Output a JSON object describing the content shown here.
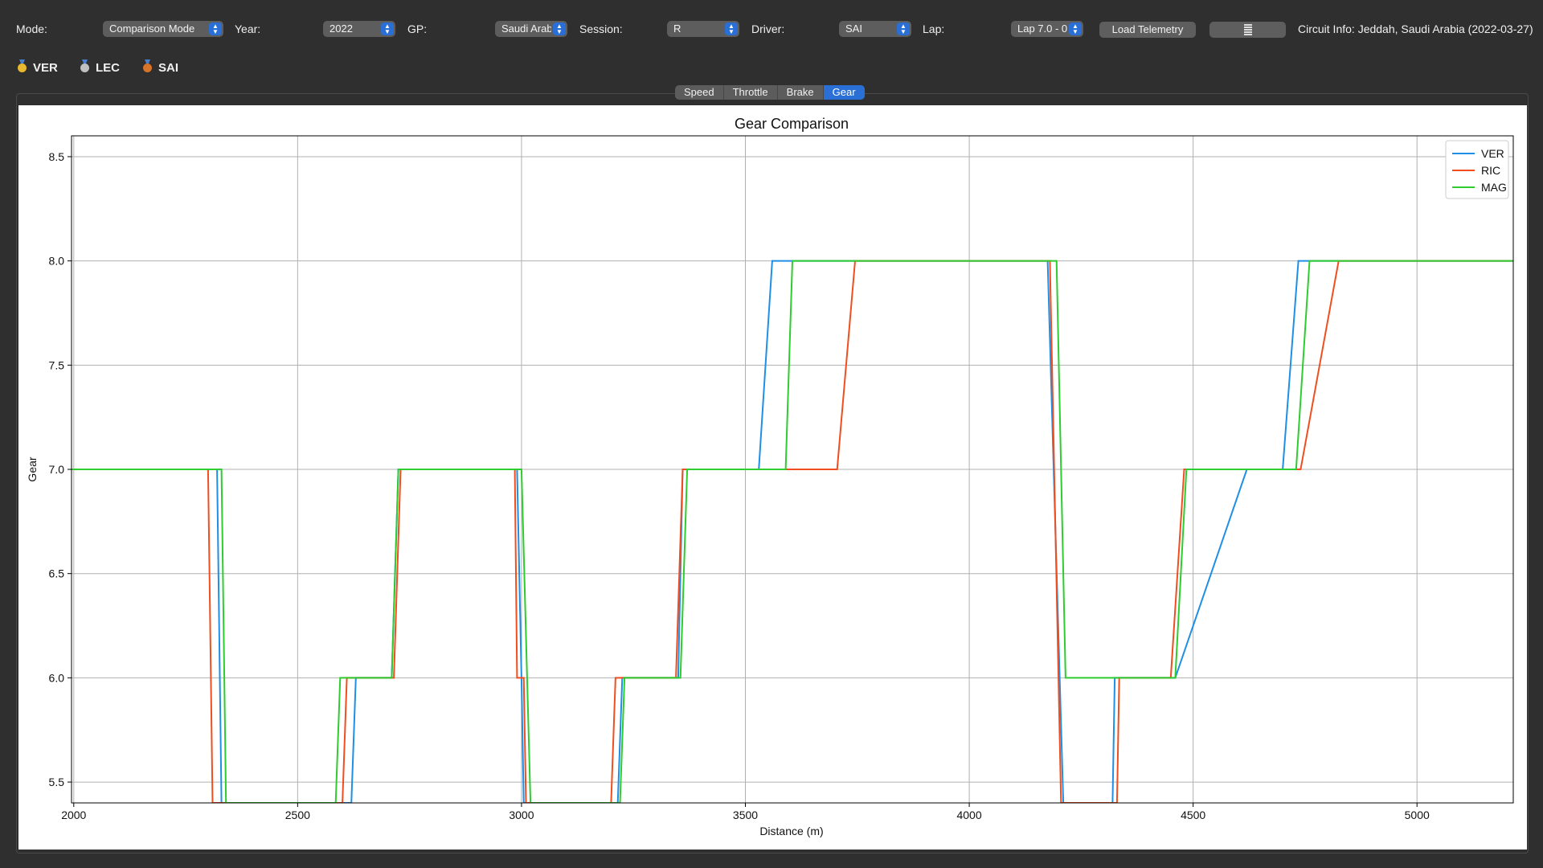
{
  "toolbar": {
    "mode_label": "Mode:",
    "mode_value": "Comparison Mode",
    "year_label": "Year:",
    "year_value": "2022",
    "gp_label": "GP:",
    "gp_value": "Saudi Arab",
    "session_label": "Session:",
    "session_value": "R",
    "driver_label": "Driver:",
    "driver_value": "SAI",
    "lap_label": "Lap:",
    "lap_value": "Lap 7.0 - 0",
    "load_button": "Load Telemetry",
    "circuit_info": "Circuit Info: Jeddah, Saudi Arabia (2022-03-27)"
  },
  "podium": [
    {
      "driver": "VER",
      "medal": "gold",
      "color": "#e8b830"
    },
    {
      "driver": "LEC",
      "medal": "silver",
      "color": "#c0c0c0"
    },
    {
      "driver": "SAI",
      "medal": "bronze",
      "color": "#d8742a"
    }
  ],
  "tabs": [
    {
      "label": "Speed",
      "active": false
    },
    {
      "label": "Throttle",
      "active": false
    },
    {
      "label": "Brake",
      "active": false
    },
    {
      "label": "Gear",
      "active": true
    }
  ],
  "chart_data": {
    "type": "line",
    "title": "Gear Comparison",
    "xlabel": "Distance (m)",
    "ylabel": "Gear",
    "xlim": [
      1995,
      5215
    ],
    "ylim": [
      5.4,
      8.6
    ],
    "xticks": [
      "2000",
      "2500",
      "3000",
      "3500",
      "4000",
      "4500",
      "5000"
    ],
    "yticks": [
      "5.5",
      "6.0",
      "6.5",
      "7.0",
      "7.5",
      "8.0",
      "8.5"
    ],
    "grid": true,
    "legend_position": "top-right",
    "series": [
      {
        "name": "VER",
        "color": "#1f8fe6",
        "points": [
          [
            1995,
            7
          ],
          [
            2320,
            7
          ],
          [
            2330,
            5.4
          ],
          [
            2620,
            5.4
          ],
          [
            2630,
            6
          ],
          [
            2710,
            6
          ],
          [
            2725,
            7
          ],
          [
            2990,
            7
          ],
          [
            3000,
            6
          ],
          [
            3005,
            5.4
          ],
          [
            3215,
            5.4
          ],
          [
            3225,
            6
          ],
          [
            3350,
            6
          ],
          [
            3360,
            7
          ],
          [
            3530,
            7
          ],
          [
            3560,
            8
          ],
          [
            4175,
            8
          ],
          [
            4210,
            5.4
          ],
          [
            4320,
            5.4
          ],
          [
            4325,
            6
          ],
          [
            4460,
            6
          ],
          [
            4620,
            7
          ],
          [
            4700,
            7
          ],
          [
            4735,
            8
          ],
          [
            5215,
            8
          ]
        ]
      },
      {
        "name": "RIC",
        "color": "#f04e1e",
        "points": [
          [
            1995,
            7
          ],
          [
            2300,
            7
          ],
          [
            2310,
            5.4
          ],
          [
            2600,
            5.4
          ],
          [
            2610,
            6
          ],
          [
            2715,
            6
          ],
          [
            2730,
            7
          ],
          [
            2985,
            7
          ],
          [
            2990,
            6
          ],
          [
            3005,
            6
          ],
          [
            3010,
            5.4
          ],
          [
            3200,
            5.4
          ],
          [
            3210,
            6
          ],
          [
            3345,
            6
          ],
          [
            3360,
            7
          ],
          [
            3705,
            7
          ],
          [
            3745,
            8
          ],
          [
            4180,
            8
          ],
          [
            4205,
            5.4
          ],
          [
            4330,
            5.4
          ],
          [
            4335,
            6
          ],
          [
            4450,
            6
          ],
          [
            4480,
            7
          ],
          [
            4740,
            7
          ],
          [
            4825,
            8
          ],
          [
            5215,
            8
          ]
        ]
      },
      {
        "name": "MAG",
        "color": "#2ecc2e",
        "points": [
          [
            1995,
            7
          ],
          [
            2330,
            7
          ],
          [
            2340,
            5.4
          ],
          [
            2585,
            5.4
          ],
          [
            2595,
            6
          ],
          [
            2710,
            6
          ],
          [
            2725,
            7
          ],
          [
            3000,
            7
          ],
          [
            3020,
            5.4
          ],
          [
            3220,
            5.4
          ],
          [
            3230,
            6
          ],
          [
            3355,
            6
          ],
          [
            3370,
            7
          ],
          [
            3590,
            7
          ],
          [
            3605,
            8
          ],
          [
            4195,
            8
          ],
          [
            4215,
            6
          ],
          [
            4460,
            6
          ],
          [
            4485,
            7
          ],
          [
            4730,
            7
          ],
          [
            4760,
            8
          ],
          [
            5215,
            8
          ]
        ]
      }
    ]
  }
}
